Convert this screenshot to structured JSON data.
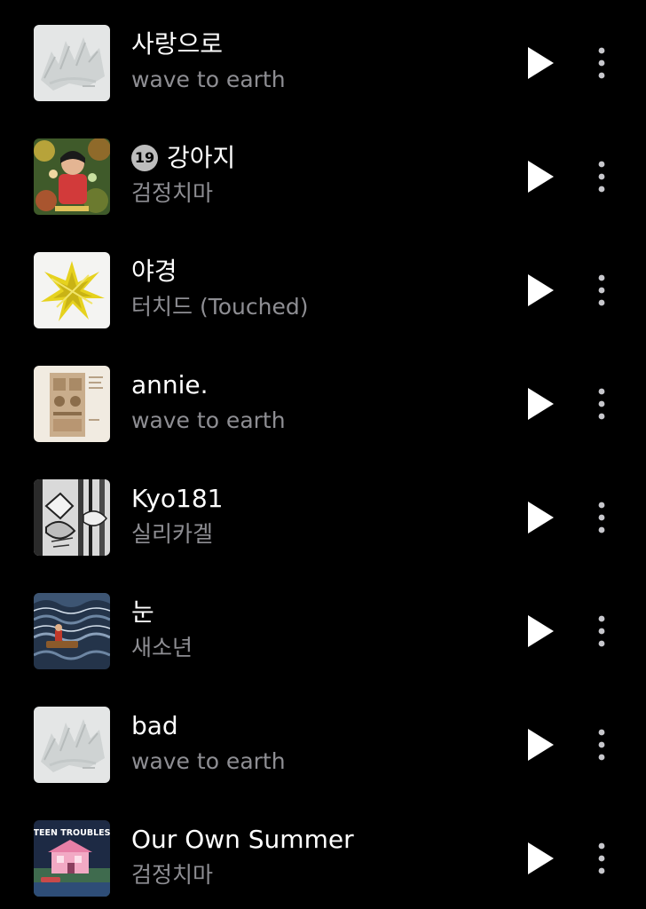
{
  "tracks": [
    {
      "title": "사랑으로",
      "artist": "wave to earth",
      "explicit": false,
      "art": "wave-to-earth-sketch"
    },
    {
      "title": "강아지",
      "artist": "검정치마",
      "explicit": true,
      "badge": "19",
      "art": "colorful-portrait"
    },
    {
      "title": "야경",
      "artist": "터치드 (Touched)",
      "explicit": false,
      "art": "yellow-burst"
    },
    {
      "title": "annie.",
      "artist": "wave to earth",
      "explicit": false,
      "art": "vintage-machine"
    },
    {
      "title": "Kyo181",
      "artist": "실리카겔",
      "explicit": false,
      "art": "monochrome-collage"
    },
    {
      "title": "눈",
      "artist": "새소년",
      "explicit": false,
      "art": "ocean-boat"
    },
    {
      "title": "bad",
      "artist": "wave to earth",
      "explicit": false,
      "art": "wave-to-earth-sketch"
    },
    {
      "title": "Our Own Summer",
      "artist": "검정치마",
      "explicit": false,
      "art": "teen-troubles",
      "art_text": "TEEN TROUBLES"
    }
  ],
  "icons": {
    "play": "play-icon",
    "more": "more-vertical-icon"
  },
  "colors": {
    "background": "#000000",
    "title": "#ffffff",
    "artist": "#8e8e93",
    "badge": "#bdbdbd"
  }
}
